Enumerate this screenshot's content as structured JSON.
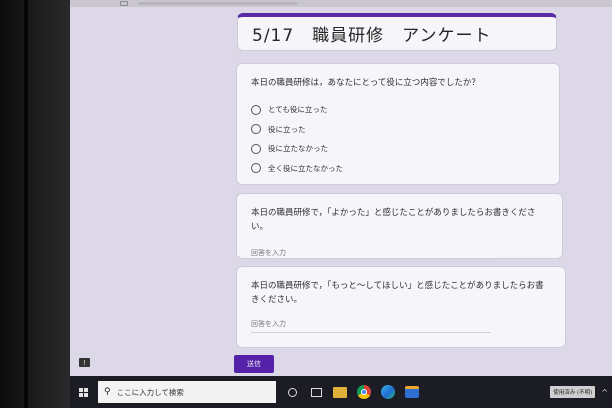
{
  "form": {
    "title": "5/17　職員研修　アンケート"
  },
  "questions": [
    {
      "text": "本日の職員研修は，あなたにとって役に立つ内容でしたか？",
      "options": [
        "とても役に立った",
        "役に立った",
        "役に立たなかった",
        "全く役に立たなかった"
      ]
    },
    {
      "text": "本日の職員研修で，「よかった」と感じたことがありましたらお書きください。",
      "answer_placeholder": "回答を入力"
    },
    {
      "text": "本日の職員研修で，「もっと～してほしい」と感じたことがありましたらお書きください。",
      "answer_placeholder": "回答を入力"
    }
  ],
  "submit_label": "送信",
  "taskbar": {
    "search_placeholder": "ここに入力して検索",
    "ime_status": "使用済み (不明)"
  },
  "colors": {
    "accent": "#5322a8",
    "page_background": "#dcd8e8",
    "card_background": "#f6f5f9",
    "taskbar": "#1c1d24"
  },
  "icons": [
    "url-lock-icon",
    "feedback-icon",
    "windows-start-icon",
    "search-icon",
    "cortana-icon",
    "task-view-icon",
    "file-explorer-icon",
    "chrome-icon",
    "edge-icon",
    "app-icon",
    "tray-chevron-icon"
  ]
}
